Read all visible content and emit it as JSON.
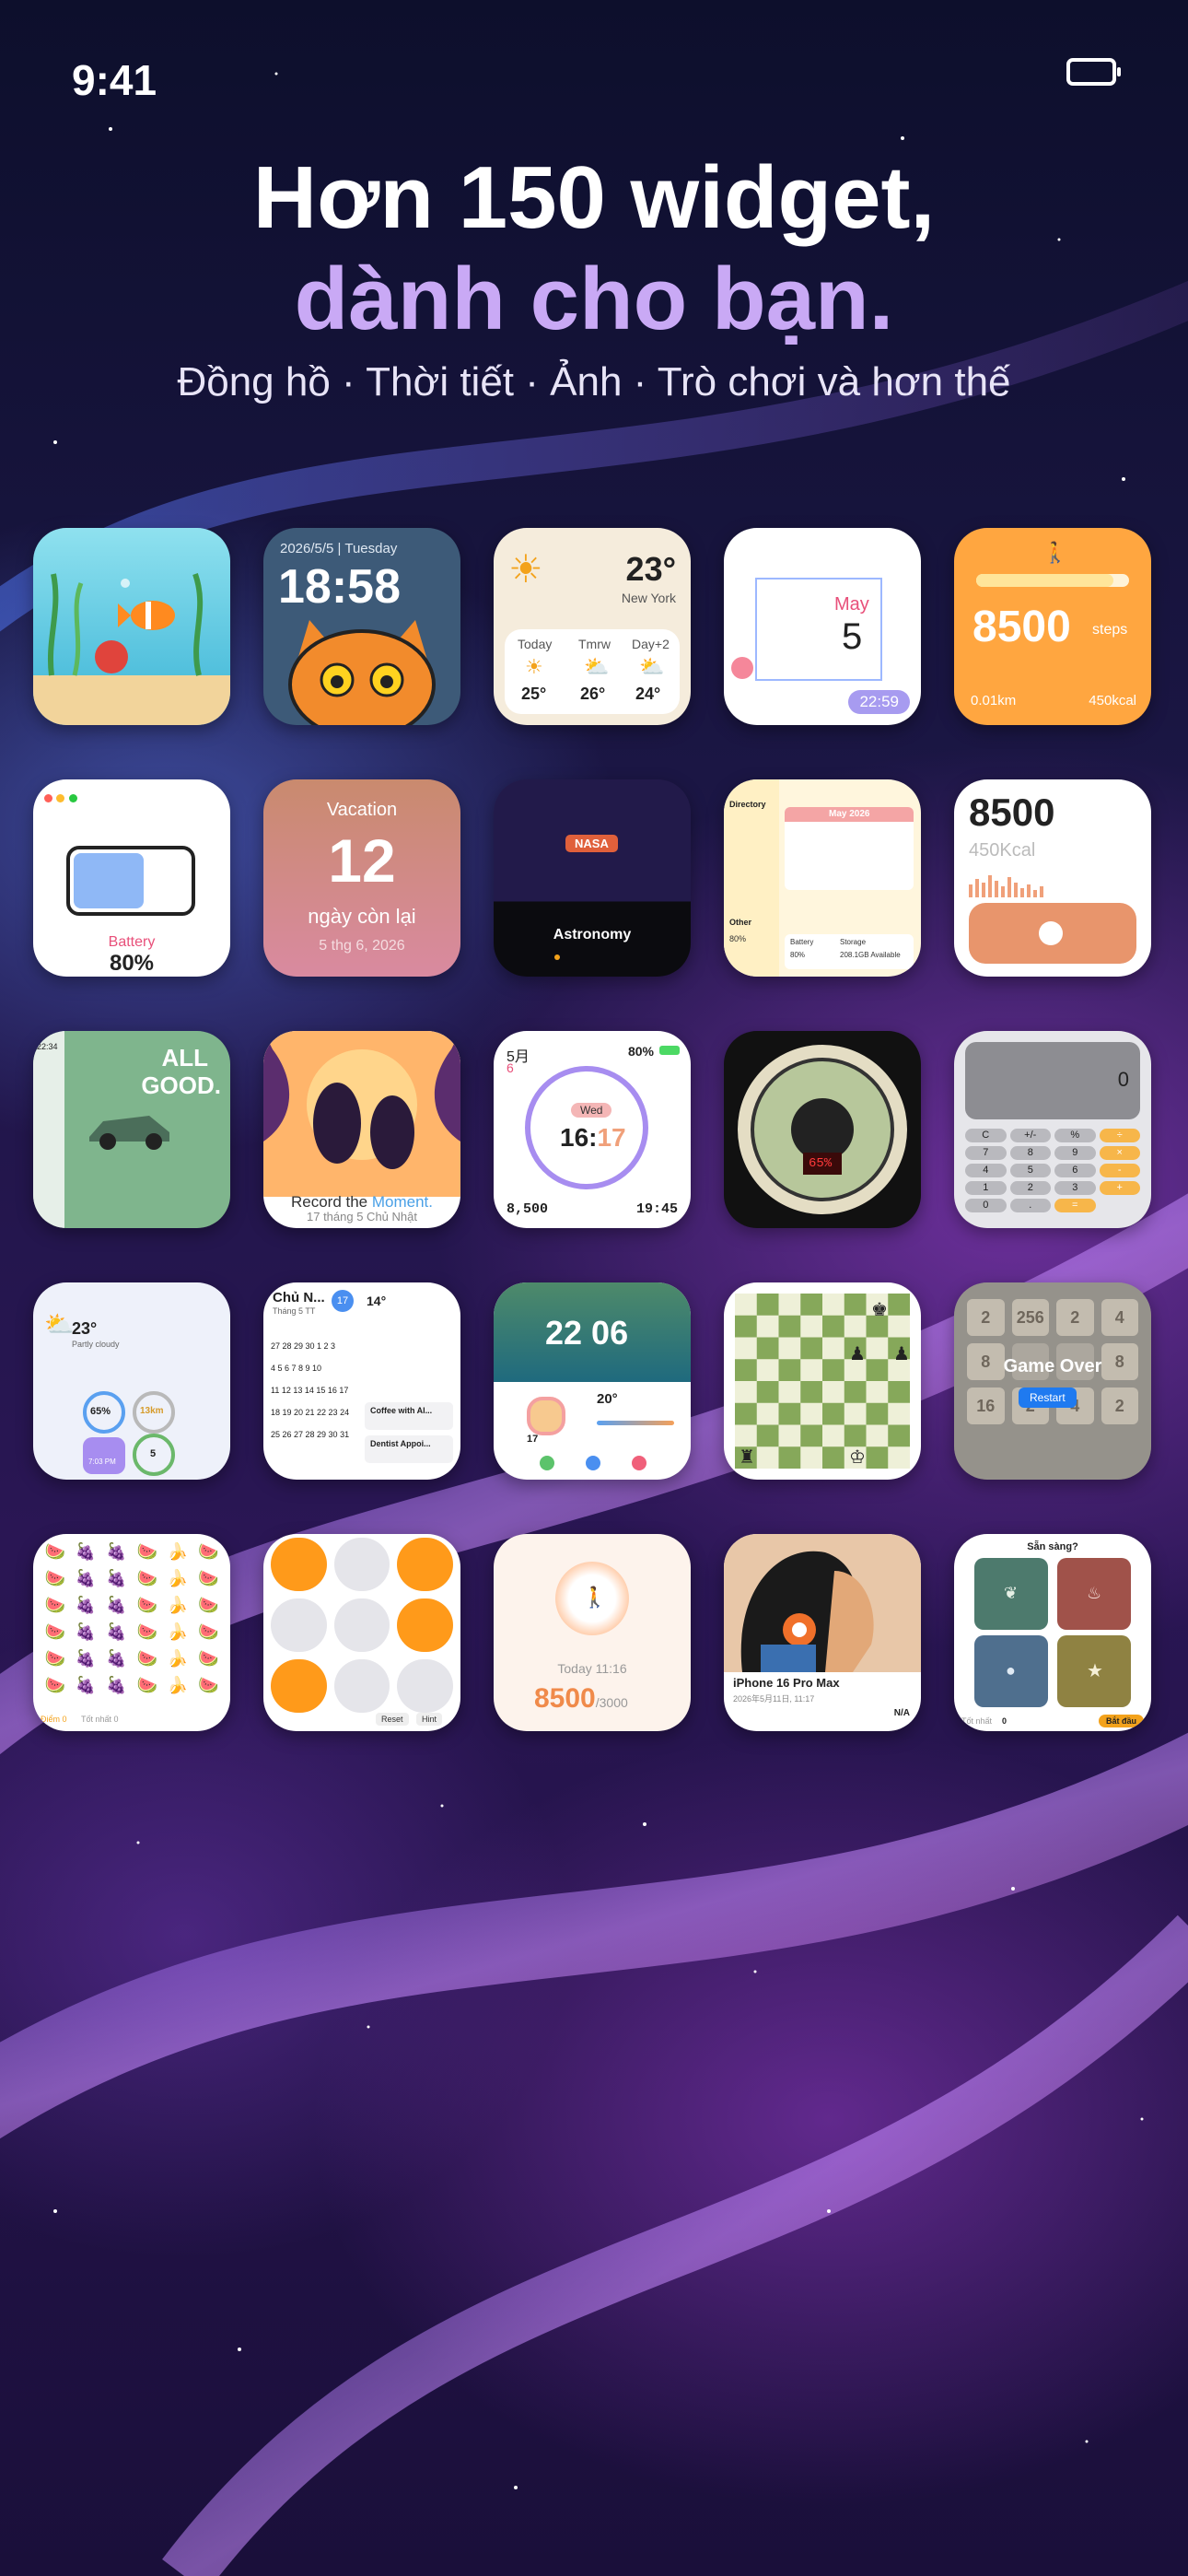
{
  "status": {
    "time": "9:41"
  },
  "hero": {
    "line1": "Hơn 150 widget,",
    "line2": "dành cho bạn.",
    "subtitle": "Đồng hồ · Thời tiết · Ảnh · Trò chơi và hơn thế"
  },
  "widgets": {
    "clock_cat": {
      "date": "2026/5/5 | Tuesday",
      "time": "18:58"
    },
    "weather": {
      "temp": "23°",
      "city": "New York",
      "days": [
        "Today",
        "Tmrw",
        "Day+2"
      ],
      "temps": [
        "25°",
        "26°",
        "24°"
      ]
    },
    "calendar_card": {
      "month": "May",
      "day": "5",
      "time": "22:59"
    },
    "steps": {
      "value": "8500",
      "unit": "steps",
      "distance": "0.01km",
      "kcal": "450kcal"
    },
    "battery": {
      "label": "Battery",
      "value": "80%"
    },
    "vacation": {
      "title": "Vacation",
      "days": "12",
      "label": "ngày còn lại",
      "date": "5 thg 6, 2026"
    },
    "nasa": {
      "badge": "NASA",
      "title": "Astronomy"
    },
    "directory": {
      "title": "Directory",
      "month": "May 2026",
      "other": "Other",
      "other_value": "80%",
      "battery": "Battery",
      "battery_value": "80%",
      "storage": "Storage",
      "storage_value": "208.1GB Available"
    },
    "kcal": {
      "value": "8500",
      "kcal": "450Kcal"
    },
    "all_good": {
      "line1": "ALL",
      "line2": "GOOD.",
      "time": "22:34"
    },
    "parrots": {
      "caption1": "Record the",
      "caption2": "Moment.",
      "date": "17 tháng 5 Chủ Nhật"
    },
    "ring_clock": {
      "month": "5月",
      "day": "6",
      "battery": "80%",
      "weekday": "Wed",
      "time_h": "16:",
      "time_m": "17",
      "steps": "8,500",
      "sunset": "19:45"
    },
    "gauge": {
      "reading": "65%"
    },
    "calculator": {
      "display": "0",
      "keys": [
        "C",
        "+/-",
        "%",
        "÷",
        "7",
        "8",
        "9",
        "×",
        "4",
        "5",
        "6",
        "-",
        "1",
        "2",
        "3",
        "+",
        "0",
        ".",
        "="
      ]
    },
    "weather_rings": {
      "temp": "23°",
      "cond": "Partly cloudy",
      "ring1": "65%",
      "ring2": "13km",
      "ring3": "5",
      "time": "7:03 PM"
    },
    "month_cal": {
      "title": "Chủ N...",
      "sub": "Tháng 5 TT",
      "badge": "17",
      "temp": "14°",
      "event1": "Coffee with Al...",
      "event2": "Dentist Appoi..."
    },
    "photo_clock": {
      "time": "22 06",
      "temp": "20°",
      "day": "17"
    },
    "chess": {},
    "game2048": {
      "title": "Game Over",
      "button": "Restart",
      "cells": [
        "2",
        "256",
        "2",
        "4",
        "8",
        "",
        "",
        "8",
        "16",
        "2",
        "4",
        "2"
      ]
    },
    "fruit": {
      "score": "Điểm 0",
      "best": "Tốt nhất 0"
    },
    "dots": {
      "reset": "Reset",
      "hint": "Hint"
    },
    "walk": {
      "date": "Today 11:16",
      "value": "8500",
      "goal": "/3000"
    },
    "portrait": {
      "model": "iPhone 16 Pro Max",
      "date": "2026年5月11日, 11:17",
      "na": "N/A"
    },
    "memory": {
      "title": "Sẵn sàng?",
      "best": "Tốt nhất",
      "best_value": "0",
      "start": "Bắt đầu"
    }
  },
  "colors": {
    "accent_purple": "#c9a9f5",
    "steps_orange": "#ffa640",
    "vacation_rose": "#c98a86"
  }
}
